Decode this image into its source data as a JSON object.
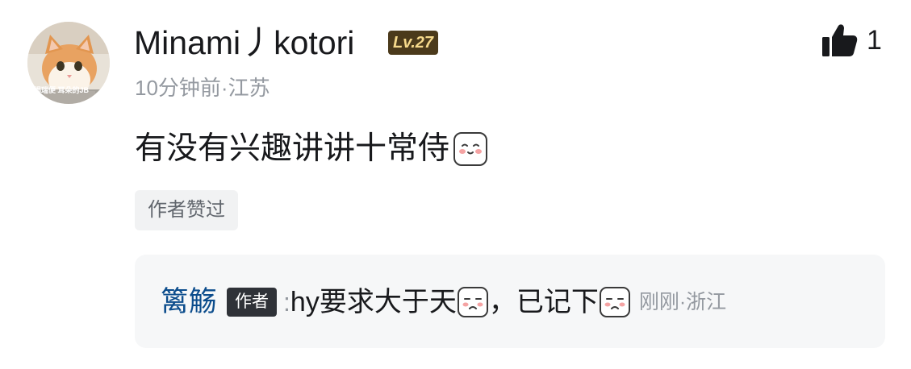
{
  "comment": {
    "username": "Minami丿kotori",
    "level_badge": "Lv.27",
    "meta": "10分钟前·江苏",
    "like_count": "1",
    "content_text": "有没有兴趣讲讲十常侍",
    "content_emoji": "blush-face-emoji",
    "author_liked_label": "作者赞过",
    "avatar_text": "揭瑞便 耳朵的JB",
    "icons": {
      "like": "thumbs-up-icon"
    }
  },
  "reply": {
    "username": "篱觞",
    "author_tag": "作者",
    "colon": ":",
    "text_part1": "hy要求大于天",
    "text_part2": "，已记下",
    "emoji": "cry-face-emoji",
    "meta": "刚刚·浙江"
  },
  "colors": {
    "username": "#18191c",
    "meta": "#9499a0",
    "reply_user": "#0b4c8c",
    "level_badge_bg": "#4b3a1b",
    "level_badge_text": "#f6d98b"
  }
}
